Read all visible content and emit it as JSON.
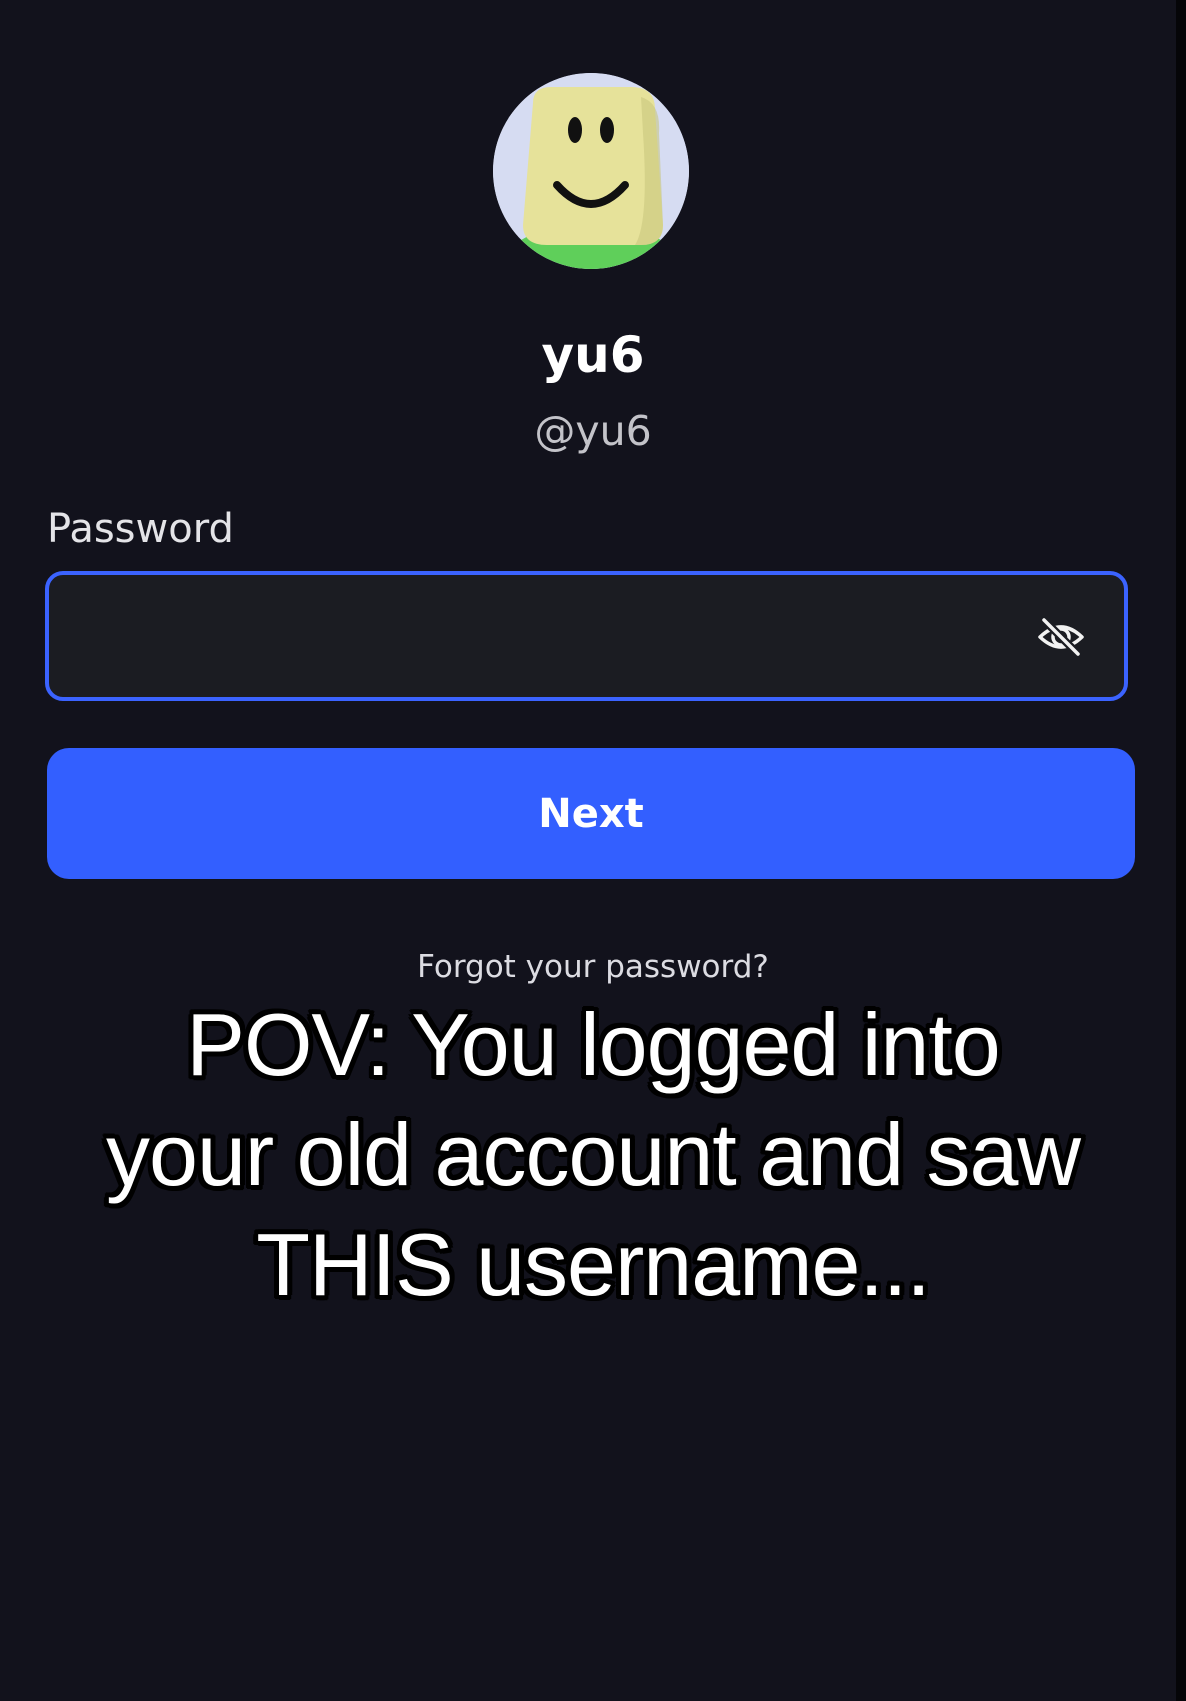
{
  "profile": {
    "display_name": "yu6",
    "handle": "@yu6",
    "avatar_icon": "smiley-avatar"
  },
  "password": {
    "label": "Password",
    "value": "",
    "placeholder": "",
    "toggle_icon": "eye-off-icon"
  },
  "actions": {
    "next_label": "Next",
    "forgot_label": "Forgot your password?"
  },
  "caption": {
    "lines": [
      "POV: You logged into",
      "your old account and saw",
      "THIS username..."
    ]
  },
  "colors": {
    "background": "#12121c",
    "accent": "#335fff",
    "field_border": "#3b63ff",
    "field_bg": "#1b1c22"
  }
}
